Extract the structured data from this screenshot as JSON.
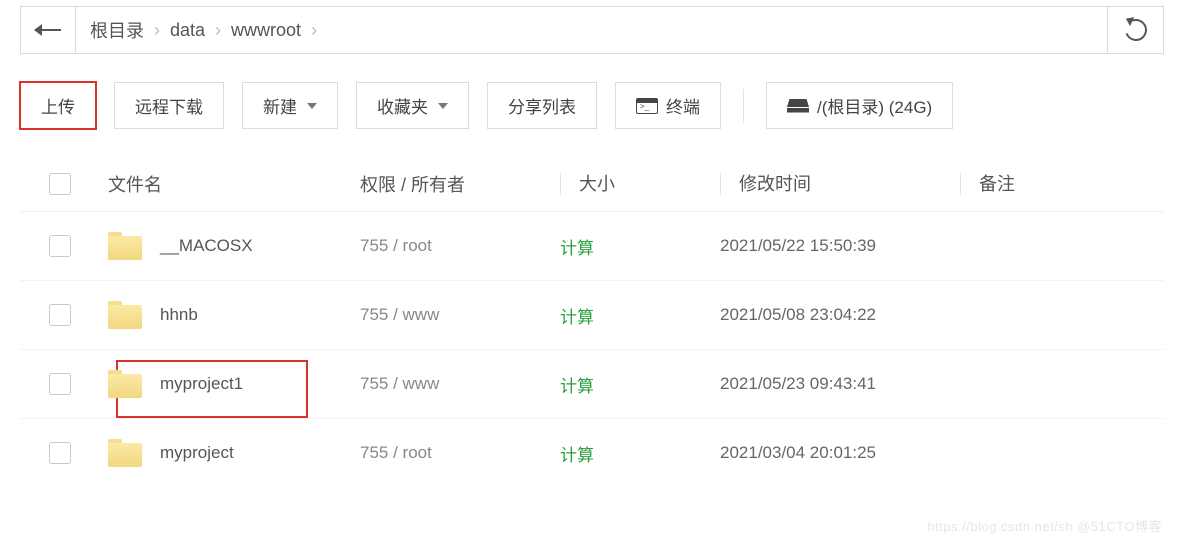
{
  "breadcrumb": {
    "items": [
      "根目录",
      "data",
      "wwwroot"
    ]
  },
  "toolbar": {
    "upload": "上传",
    "remote_download": "远程下载",
    "new": "新建",
    "favorites": "收藏夹",
    "share_list": "分享列表",
    "terminal": "终端",
    "root_disk": "/(根目录) (24G)"
  },
  "table": {
    "headers": {
      "name": "文件名",
      "perm": "权限 / 所有者",
      "size": "大小",
      "mtime": "修改时间",
      "note": "备注"
    },
    "rows": [
      {
        "name": "__MACOSX",
        "perm": "755 / root",
        "size": "计算",
        "mtime": "2021/05/22 15:50:39",
        "highlighted": false
      },
      {
        "name": "hhnb",
        "perm": "755 / www",
        "size": "计算",
        "mtime": "2021/05/08 23:04:22",
        "highlighted": false
      },
      {
        "name": "myproject1",
        "perm": "755 / www",
        "size": "计算",
        "mtime": "2021/05/23 09:43:41",
        "highlighted": true
      },
      {
        "name": "myproject",
        "perm": "755 / root",
        "size": "计算",
        "mtime": "2021/03/04 20:01:25",
        "highlighted": false
      }
    ]
  },
  "watermark": "https://blog.csdn.net/sh @51CTO博客"
}
